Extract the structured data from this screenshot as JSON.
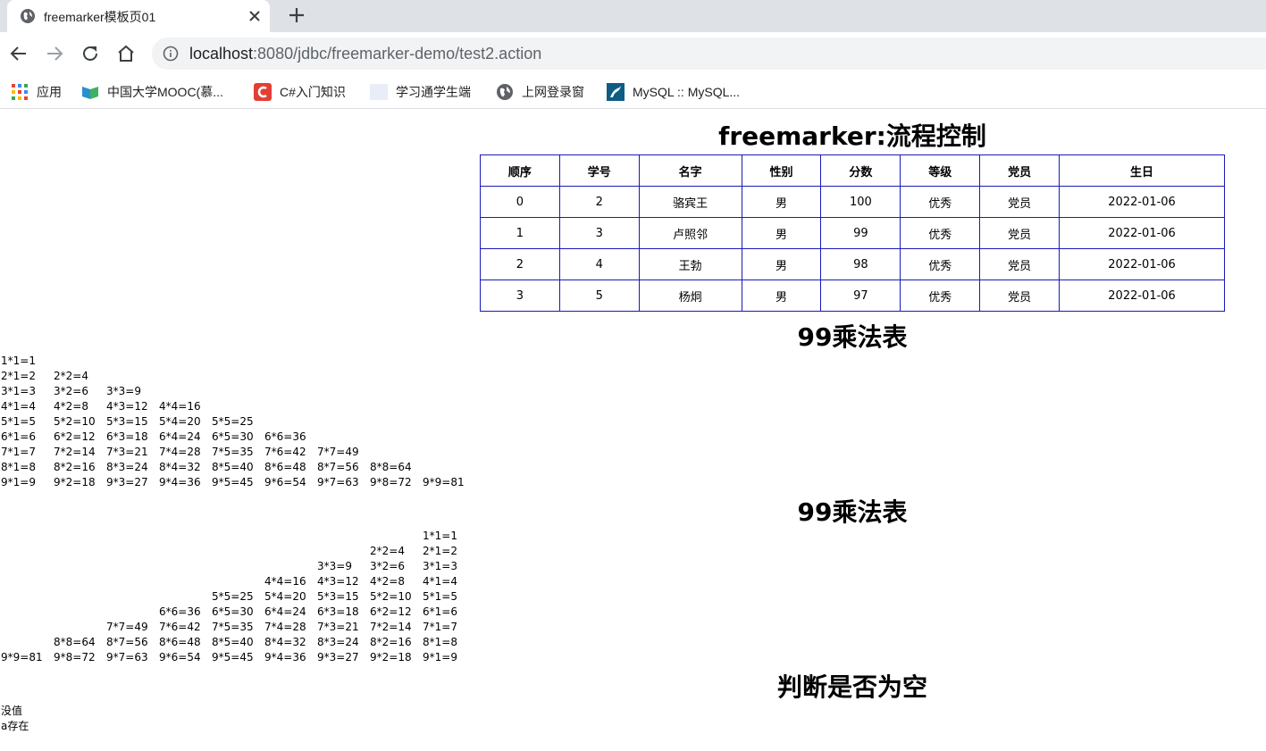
{
  "tab": {
    "title": "freemarker模板页01"
  },
  "omnibox": {
    "host": "localhost",
    "rest": ":8080/jdbc/freemarker-demo/test2.action"
  },
  "bookmarks": [
    {
      "label": "应用",
      "icon": "apps-grid-icon"
    },
    {
      "label": "中国大学MOOC(慕...",
      "icon": "mooc-book-icon"
    },
    {
      "label": "C#入门知识",
      "icon": "csdn-c-icon"
    },
    {
      "label": "学习通学生端",
      "icon": "blank-page-icon"
    },
    {
      "label": "上网登录窗",
      "icon": "globe-icon"
    },
    {
      "label": "MySQL :: MySQL...",
      "icon": "mysql-icon"
    }
  ],
  "page": {
    "title": "freemarker:流程控制",
    "table": {
      "headers": [
        "顺序",
        "学号",
        "名字",
        "性别",
        "分数",
        "等级",
        "党员",
        "生日"
      ],
      "rows": [
        [
          "0",
          "2",
          "骆宾王",
          "男",
          "100",
          "优秀",
          "党员",
          "2022-01-06"
        ],
        [
          "1",
          "3",
          "卢照邻",
          "男",
          "99",
          "优秀",
          "党员",
          "2022-01-06"
        ],
        [
          "2",
          "4",
          "王勃",
          "男",
          "98",
          "优秀",
          "党员",
          "2022-01-06"
        ],
        [
          "3",
          "5",
          "杨炯",
          "男",
          "97",
          "优秀",
          "党员",
          "2022-01-06"
        ]
      ]
    },
    "table_border_color": "#1a1ab8",
    "mult1_title": "99乘法表",
    "mult2_title": "99乘法表",
    "mult_left": [
      [
        "1*1=1"
      ],
      [
        "2*1=2",
        "2*2=4"
      ],
      [
        "3*1=3",
        "3*2=6",
        "3*3=9"
      ],
      [
        "4*1=4",
        "4*2=8",
        "4*3=12",
        "4*4=16"
      ],
      [
        "5*1=5",
        "5*2=10",
        "5*3=15",
        "5*4=20",
        "5*5=25"
      ],
      [
        "6*1=6",
        "6*2=12",
        "6*3=18",
        "6*4=24",
        "6*5=30",
        "6*6=36"
      ],
      [
        "7*1=7",
        "7*2=14",
        "7*3=21",
        "7*4=28",
        "7*5=35",
        "7*6=42",
        "7*7=49"
      ],
      [
        "8*1=8",
        "8*2=16",
        "8*3=24",
        "8*4=32",
        "8*5=40",
        "8*6=48",
        "8*7=56",
        "8*8=64"
      ],
      [
        "9*1=9",
        "9*2=18",
        "9*3=27",
        "9*4=36",
        "9*5=45",
        "9*6=54",
        "9*7=63",
        "9*8=72",
        "9*9=81"
      ]
    ],
    "mult_right": [
      [
        "1*1=1"
      ],
      [
        "2*2=4",
        "2*1=2"
      ],
      [
        "3*3=9",
        "3*2=6",
        "3*1=3"
      ],
      [
        "4*4=16",
        "4*3=12",
        "4*2=8",
        "4*1=4"
      ],
      [
        "5*5=25",
        "5*4=20",
        "5*3=15",
        "5*2=10",
        "5*1=5"
      ],
      [
        "6*6=36",
        "6*5=30",
        "6*4=24",
        "6*3=18",
        "6*2=12",
        "6*1=6"
      ],
      [
        "7*7=49",
        "7*6=42",
        "7*5=35",
        "7*4=28",
        "7*3=21",
        "7*2=14",
        "7*1=7"
      ],
      [
        "8*8=64",
        "8*7=56",
        "8*6=48",
        "8*5=40",
        "8*4=32",
        "8*3=24",
        "8*2=16",
        "8*1=8"
      ],
      [
        "9*9=81",
        "9*8=72",
        "9*7=63",
        "9*6=54",
        "9*5=45",
        "9*4=36",
        "9*3=27",
        "9*2=18",
        "9*1=9"
      ]
    ],
    "empty_title": "判断是否为空",
    "empty_lines": [
      "没值",
      "a存在"
    ]
  }
}
